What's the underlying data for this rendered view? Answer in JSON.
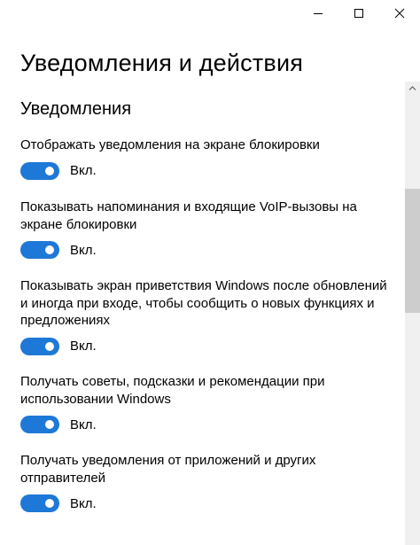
{
  "window": {
    "controls": [
      "minimize",
      "maximize",
      "close"
    ]
  },
  "page": {
    "title": "Уведомления и действия"
  },
  "section": {
    "title": "Уведомления"
  },
  "settings": [
    {
      "label": "Отображать уведомления на экране блокировки",
      "state": "Вкл."
    },
    {
      "label": "Показывать напоминания и входящие VoIP-вызовы на экране блокировки",
      "state": "Вкл."
    },
    {
      "label": "Показывать экран приветствия Windows после обновлений и иногда при входе, чтобы сообщить о новых функциях и предложениях",
      "state": "Вкл."
    },
    {
      "label": "Получать советы, подсказки и рекомендации при использовании Windows",
      "state": "Вкл."
    },
    {
      "label": "Получать уведомления от приложений и других отправителей",
      "state": "Вкл."
    }
  ],
  "colors": {
    "toggle_on": "#1e78d7",
    "scrollbar_thumb": "#cdcdcd",
    "scrollbar_track": "#f0f0f0"
  }
}
